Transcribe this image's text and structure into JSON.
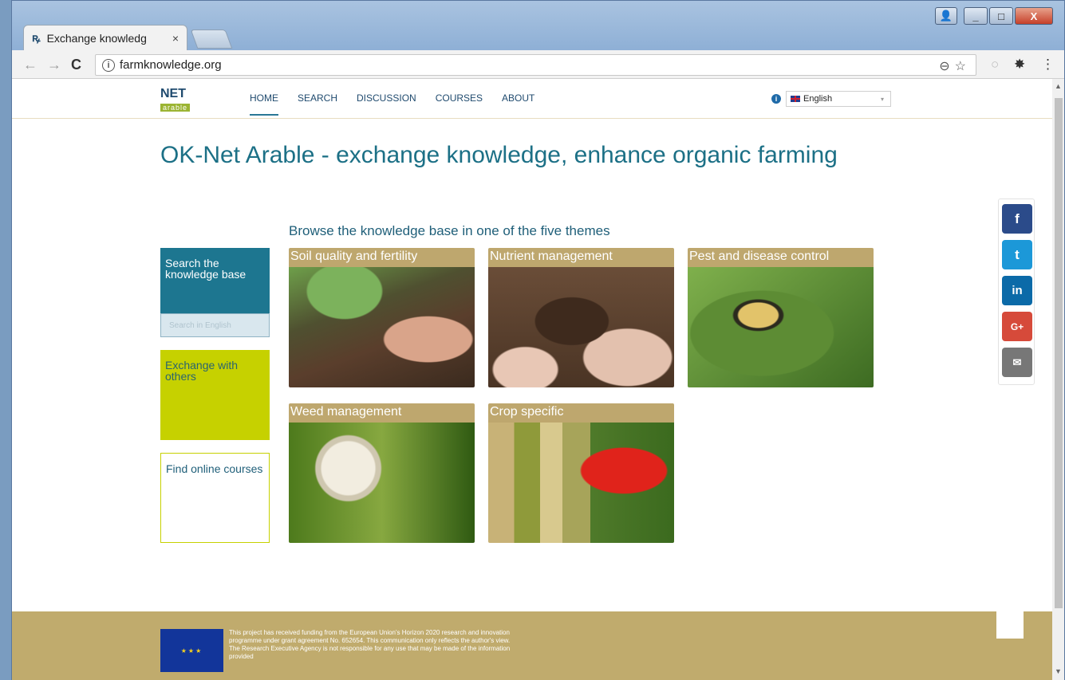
{
  "browser": {
    "tab_title": "Exchange knowledg",
    "tab_close": "×",
    "url": "farmknowledge.org",
    "info_glyph": "i",
    "nav": {
      "back": "←",
      "forward": "→",
      "reload": "C"
    },
    "omni_icons": {
      "zoom": "⊖",
      "star": "☆"
    },
    "toolbar_icons": {
      "extension": "○",
      "gear": "✸",
      "menu": "⋮"
    },
    "window": {
      "minimize": "_",
      "maximize": "□",
      "close": "X",
      "user": "👤"
    }
  },
  "site": {
    "logo": {
      "net": "NET",
      "sub": "arable"
    },
    "menu": [
      "HOME",
      "SEARCH",
      "DISCUSSION",
      "COURSES",
      "ABOUT"
    ],
    "language": {
      "info_glyph": "i",
      "selected": "English",
      "caret": "▾"
    },
    "hero_title": "OK-Net Arable - exchange knowledge, enhance organic farming",
    "browse_heading": "Browse the knowledge base in one of the five themes",
    "side": {
      "search_title": "Search the knowledge base",
      "search_placeholder": "Search in English",
      "exchange": "Exchange with others",
      "courses": "Find online courses"
    },
    "themes": [
      "Soil quality and fertility",
      "Nutrient management",
      "Pest and disease control",
      "Weed management",
      "Crop specific"
    ],
    "share": {
      "facebook": "f",
      "twitter": "t",
      "linkedin": "in",
      "google": "G+",
      "email": "✉"
    },
    "footer": {
      "eu_stars": "★★★",
      "funding_text": "This project has received funding from the European Union's Horizon 2020 research and innovation programme under grant agreement No. 652654. This communication only reflects the author's view. The Research Executive Agency is not responsible for any use that may be made of the information provided"
    }
  }
}
